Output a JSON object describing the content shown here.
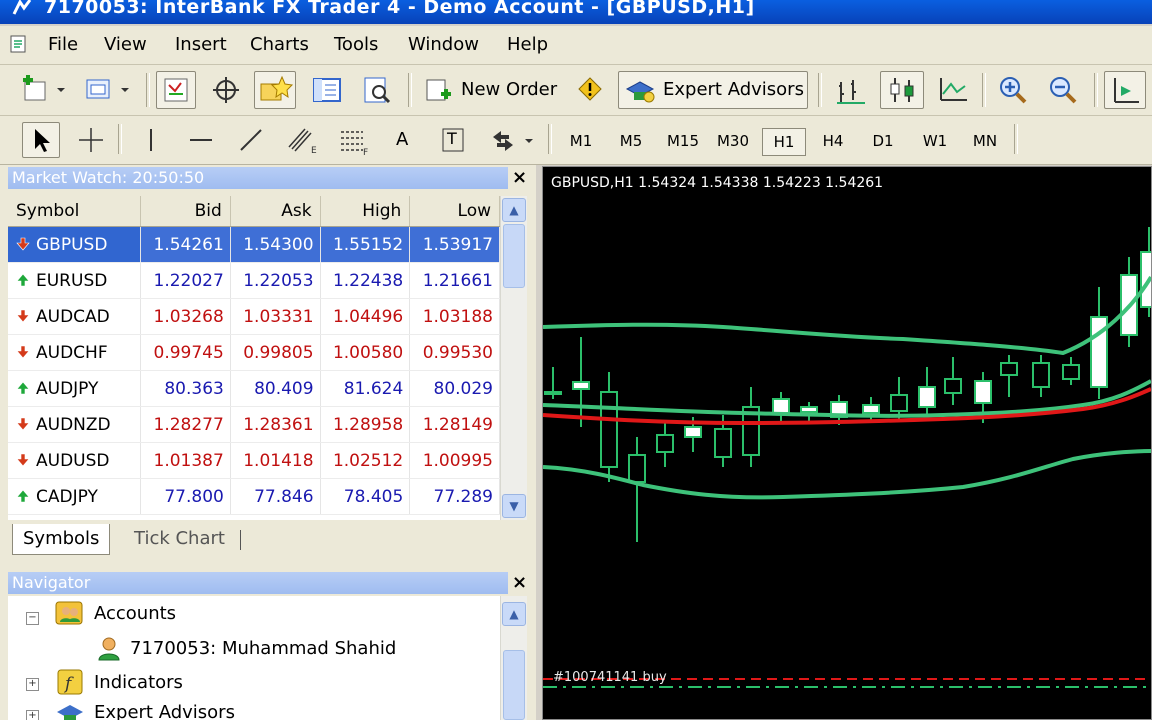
{
  "window": {
    "title": "7170053: InterBank FX Trader 4 - Demo Account - [GBPUSD,H1]"
  },
  "menu": [
    "File",
    "View",
    "Insert",
    "Charts",
    "Tools",
    "Window",
    "Help"
  ],
  "toolbar": {
    "new_order": "New Order",
    "expert_advisors": "Expert Advisors"
  },
  "drawing_tools": {
    "text_tool": "A",
    "label_tool": "T"
  },
  "timeframes": [
    "M1",
    "M5",
    "M15",
    "M30",
    "H1",
    "H4",
    "D1",
    "W1",
    "MN"
  ],
  "active_timeframe": "H1",
  "market_watch": {
    "title": "Market Watch: 20:50:50",
    "columns": [
      "Symbol",
      "Bid",
      "Ask",
      "High",
      "Low"
    ],
    "rows": [
      {
        "symbol": "GBPUSD",
        "bid": "1.54261",
        "ask": "1.54300",
        "high": "1.55152",
        "low": "1.53917",
        "dir": "down",
        "selected": true
      },
      {
        "symbol": "EURUSD",
        "bid": "1.22027",
        "ask": "1.22053",
        "high": "1.22438",
        "low": "1.21661",
        "dir": "up"
      },
      {
        "symbol": "AUDCAD",
        "bid": "1.03268",
        "ask": "1.03331",
        "high": "1.04496",
        "low": "1.03188",
        "dir": "down"
      },
      {
        "symbol": "AUDCHF",
        "bid": "0.99745",
        "ask": "0.99805",
        "high": "1.00580",
        "low": "0.99530",
        "dir": "down"
      },
      {
        "symbol": "AUDJPY",
        "bid": "80.363",
        "ask": "80.409",
        "high": "81.624",
        "low": "80.029",
        "dir": "up"
      },
      {
        "symbol": "AUDNZD",
        "bid": "1.28277",
        "ask": "1.28361",
        "high": "1.28958",
        "low": "1.28149",
        "dir": "down"
      },
      {
        "symbol": "AUDUSD",
        "bid": "1.01387",
        "ask": "1.01418",
        "high": "1.02512",
        "low": "1.00995",
        "dir": "down"
      },
      {
        "symbol": "CADJPY",
        "bid": "77.800",
        "ask": "77.846",
        "high": "78.405",
        "low": "77.289",
        "dir": "up"
      }
    ],
    "tabs": [
      "Symbols",
      "Tick Chart"
    ]
  },
  "navigator": {
    "title": "Navigator",
    "accounts": "Accounts",
    "account": "7170053: Muhammad Shahid",
    "indicators": "Indicators",
    "expert_advisors": "Expert Advisors"
  },
  "chart": {
    "info": "GBPUSD,H1  1.54324 1.54338 1.54223 1.54261",
    "trade_label": "#100741141 buy"
  },
  "colors": {
    "up": "#1a1ab0",
    "down": "#c01010",
    "band": "#3ec27a",
    "ma": "#e01818",
    "candle_bull": "#ffffff",
    "candle_bear": "#000000",
    "wick": "#2bbf6a"
  }
}
